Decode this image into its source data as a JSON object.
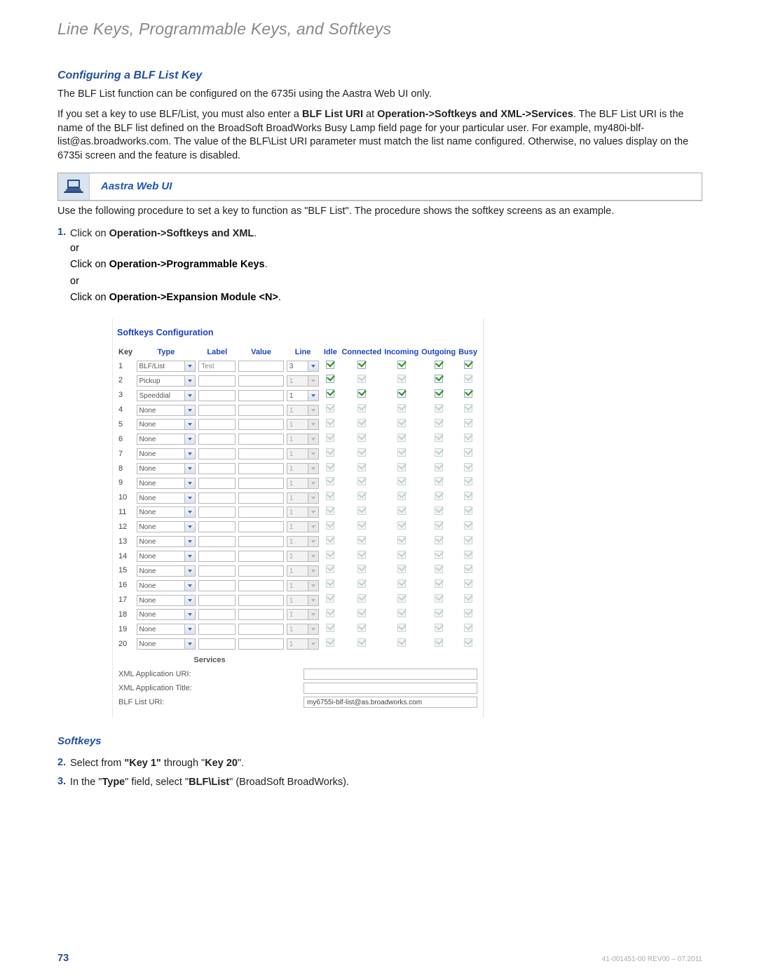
{
  "chapter_title": "Line Keys, Programmable Keys, and Softkeys",
  "section_title": "Configuring a BLF List Key",
  "intro_para": "The BLF List function can be configured on the 6735i using the Aastra Web UI only.",
  "detail_para": {
    "lead": "If you set a key to use BLF/List, you must also enter a ",
    "b1": "BLF List URI",
    "t1": " at ",
    "b2": "Operation->Softkeys and XML->Services",
    "tail": ". The BLF List URI is the name of the BLF list defined on the BroadSoft BroadWorks Busy Lamp field page for your particular user. For example, my480i-blf-list@as.broadworks.com. The value of the BLF\\List URI parameter must match the list name configured. Otherwise, no values display on the 6735i screen and the feature is disabled."
  },
  "banner_label": "Aastra Web UI",
  "after_banner": "Use the following procedure to set a key to function as \"BLF List\". The procedure shows the softkey screens as an example.",
  "step1": {
    "num": "1.",
    "lead": "Click on ",
    "b1": "Operation->Softkeys and XML",
    "tail": ".",
    "or": "or",
    "line2_lead": "Click on ",
    "line2_b": "Operation->Programmable Keys",
    "line2_tail": ".",
    "line3_lead": "Click on ",
    "line3_b": "Operation->Expansion Module <N>",
    "line3_tail": "."
  },
  "shot": {
    "title": "Softkeys Configuration",
    "headers": {
      "key": "Key",
      "type": "Type",
      "label": "Label",
      "value": "Value",
      "line": "Line",
      "idle": "Idle",
      "connected": "Connected",
      "incoming": "Incoming",
      "outgoing": "Outgoing",
      "busy": "Busy"
    },
    "rows": [
      {
        "key": "1",
        "type": "BLF/List",
        "type_en": true,
        "label": "Test",
        "label_en": true,
        "line": "3",
        "line_en": true,
        "idle": "on",
        "conn": "on",
        "inc": "on",
        "out": "on",
        "busy": "on"
      },
      {
        "key": "2",
        "type": "Pickup",
        "type_en": true,
        "label": "",
        "label_en": true,
        "line": "1",
        "line_en": false,
        "idle": "on",
        "conn": "off",
        "inc": "off",
        "out": "on",
        "busy": "off"
      },
      {
        "key": "3",
        "type": "Speeddial",
        "type_en": true,
        "label": "",
        "label_en": true,
        "line": "1",
        "line_en": true,
        "idle": "on",
        "conn": "on",
        "inc": "on",
        "out": "on",
        "busy": "on"
      },
      {
        "key": "4",
        "type": "None",
        "type_en": true,
        "label": "",
        "label_en": true,
        "line": "1",
        "line_en": false,
        "idle": "off",
        "conn": "off",
        "inc": "off",
        "out": "off",
        "busy": "off"
      },
      {
        "key": "5",
        "type": "None",
        "type_en": true,
        "label": "",
        "label_en": true,
        "line": "1",
        "line_en": false,
        "idle": "off",
        "conn": "off",
        "inc": "off",
        "out": "off",
        "busy": "off"
      },
      {
        "key": "6",
        "type": "None",
        "type_en": true,
        "label": "",
        "label_en": true,
        "line": "1",
        "line_en": false,
        "idle": "off",
        "conn": "off",
        "inc": "off",
        "out": "off",
        "busy": "off"
      },
      {
        "key": "7",
        "type": "None",
        "type_en": true,
        "label": "",
        "label_en": true,
        "line": "1",
        "line_en": false,
        "idle": "off",
        "conn": "off",
        "inc": "off",
        "out": "off",
        "busy": "off"
      },
      {
        "key": "8",
        "type": "None",
        "type_en": true,
        "label": "",
        "label_en": true,
        "line": "1",
        "line_en": false,
        "idle": "off",
        "conn": "off",
        "inc": "off",
        "out": "off",
        "busy": "off"
      },
      {
        "key": "9",
        "type": "None",
        "type_en": true,
        "label": "",
        "label_en": true,
        "line": "1",
        "line_en": false,
        "idle": "off",
        "conn": "off",
        "inc": "off",
        "out": "off",
        "busy": "off"
      },
      {
        "key": "10",
        "type": "None",
        "type_en": true,
        "label": "",
        "label_en": true,
        "line": "1",
        "line_en": false,
        "idle": "off",
        "conn": "off",
        "inc": "off",
        "out": "off",
        "busy": "off"
      },
      {
        "key": "11",
        "type": "None",
        "type_en": true,
        "label": "",
        "label_en": true,
        "line": "1",
        "line_en": false,
        "idle": "off",
        "conn": "off",
        "inc": "off",
        "out": "off",
        "busy": "off"
      },
      {
        "key": "12",
        "type": "None",
        "type_en": true,
        "label": "",
        "label_en": true,
        "line": "1",
        "line_en": false,
        "idle": "off",
        "conn": "off",
        "inc": "off",
        "out": "off",
        "busy": "off"
      },
      {
        "key": "13",
        "type": "None",
        "type_en": true,
        "label": "",
        "label_en": true,
        "line": "1",
        "line_en": false,
        "idle": "off",
        "conn": "off",
        "inc": "off",
        "out": "off",
        "busy": "off"
      },
      {
        "key": "14",
        "type": "None",
        "type_en": true,
        "label": "",
        "label_en": true,
        "line": "1",
        "line_en": false,
        "idle": "off",
        "conn": "off",
        "inc": "off",
        "out": "off",
        "busy": "off"
      },
      {
        "key": "15",
        "type": "None",
        "type_en": true,
        "label": "",
        "label_en": true,
        "line": "1",
        "line_en": false,
        "idle": "off",
        "conn": "off",
        "inc": "off",
        "out": "off",
        "busy": "off"
      },
      {
        "key": "16",
        "type": "None",
        "type_en": true,
        "label": "",
        "label_en": true,
        "line": "1",
        "line_en": false,
        "idle": "off",
        "conn": "off",
        "inc": "off",
        "out": "off",
        "busy": "off"
      },
      {
        "key": "17",
        "type": "None",
        "type_en": true,
        "label": "",
        "label_en": true,
        "line": "1",
        "line_en": false,
        "idle": "off",
        "conn": "off",
        "inc": "off",
        "out": "off",
        "busy": "off"
      },
      {
        "key": "18",
        "type": "None",
        "type_en": true,
        "label": "",
        "label_en": true,
        "line": "1",
        "line_en": false,
        "idle": "off",
        "conn": "off",
        "inc": "off",
        "out": "off",
        "busy": "off"
      },
      {
        "key": "19",
        "type": "None",
        "type_en": true,
        "label": "",
        "label_en": true,
        "line": "1",
        "line_en": false,
        "idle": "off",
        "conn": "off",
        "inc": "off",
        "out": "off",
        "busy": "off"
      },
      {
        "key": "20",
        "type": "None",
        "type_en": true,
        "label": "",
        "label_en": true,
        "line": "1",
        "line_en": false,
        "idle": "off",
        "conn": "off",
        "inc": "off",
        "out": "off",
        "busy": "off"
      }
    ],
    "services_header": "Services",
    "services": {
      "xml_uri_label": "XML Application URI:",
      "xml_uri_value": "",
      "xml_title_label": "XML Application Title:",
      "xml_title_value": "",
      "blf_list_label": "BLF List URI:",
      "blf_list_value": "my6755i-blf-list@as.broadworks.com"
    }
  },
  "softkeys_heading": "Softkeys",
  "step2": {
    "num": "2.",
    "lead": "Select from ",
    "b1": "\"Key 1\"",
    "mid": " through \"",
    "b2": "Key 20",
    "tail": "\"."
  },
  "step3": {
    "num": "3.",
    "lead": "In the \"",
    "b1": "Type",
    "mid": "\" field, select \"",
    "b2": "BLF\\List",
    "tail": "\" (BroadSoft BroadWorks)."
  },
  "footer": {
    "page": "73",
    "rev": "41-001451-00 REV00 – 07.2011"
  }
}
